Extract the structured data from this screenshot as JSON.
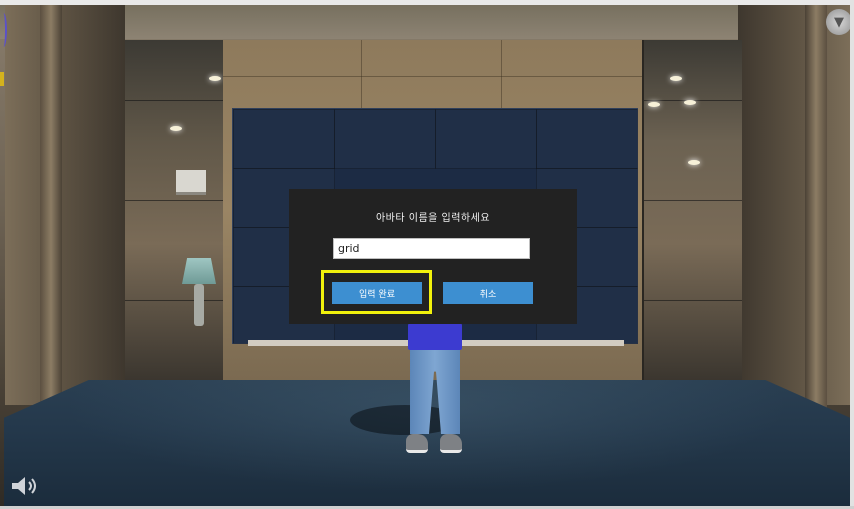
{
  "dialog": {
    "title": "아바타 이름을 입력하세요",
    "name_input_value": "grid",
    "confirm_label": "입력 완료",
    "cancel_label": "취소"
  },
  "colors": {
    "dialog_bg": "#222222",
    "button_bg": "#3d8fd1",
    "highlight_border": "#f1f10c",
    "floor": "#24384b",
    "tv_screen": "#1c2b44"
  },
  "icons": {
    "sound": "speaker-icon",
    "view_control": "compass-icon"
  }
}
